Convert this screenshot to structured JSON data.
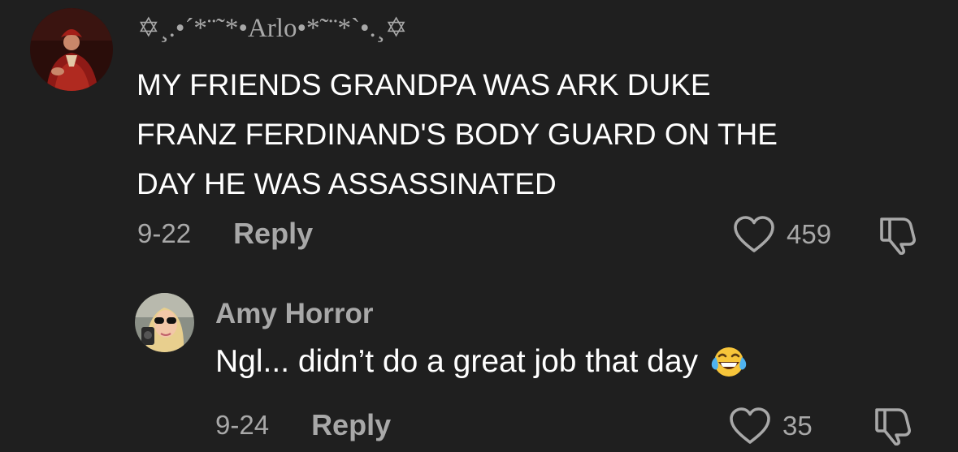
{
  "comment": {
    "username": "✡¸.•´*¨˜*•Arlo•*˜¨*`•.¸✡",
    "text_lines": [
      "MY FRIENDS GRANDPA WAS ARK DUKE",
      "FRANZ FERDINAND'S BODY GUARD ON THE",
      "DAY HE WAS ASSASSINATED"
    ],
    "date": "9-22",
    "reply_label": "Reply",
    "like_count": "459",
    "avatar_icon": "avatar-red-robed-figure"
  },
  "reply": {
    "username": "Amy Horror",
    "text": "Ngl... didn’t do a great job that day",
    "emoji": "face-with-tears-of-joy",
    "date": "9-24",
    "reply_label": "Reply",
    "like_count": "35",
    "avatar_icon": "avatar-woman-sunglasses"
  },
  "colors": {
    "background": "#1f1f1f",
    "primary_text": "#ffffff",
    "secondary_text": "#a8a8a8"
  }
}
